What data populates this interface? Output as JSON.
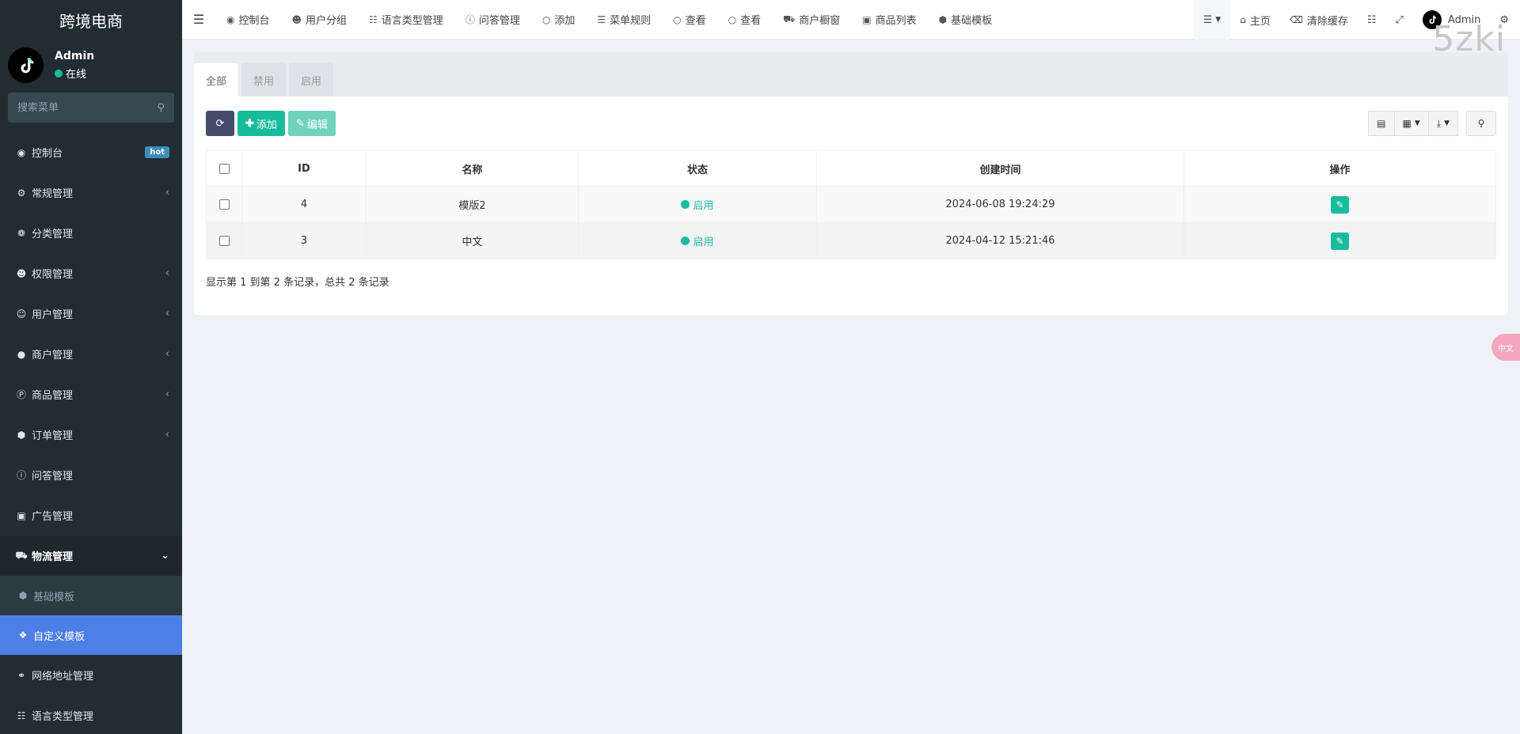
{
  "sidebar": {
    "logo": "跨境电商",
    "user": {
      "name": "Admin",
      "status": "在线"
    },
    "search_placeholder": "搜索菜单",
    "items": [
      {
        "label": "控制台",
        "icon": "dashboard-icon",
        "badge": "hot"
      },
      {
        "label": "常规管理",
        "icon": "cogs-icon"
      },
      {
        "label": "分类管理",
        "icon": "leaf-icon"
      },
      {
        "label": "权限管理",
        "icon": "group-icon"
      },
      {
        "label": "用户管理",
        "icon": "user-circle-icon"
      },
      {
        "label": "商户管理",
        "icon": "apple-icon"
      },
      {
        "label": "商品管理",
        "icon": "product-p-icon"
      },
      {
        "label": "订单管理",
        "icon": "cube-icon"
      },
      {
        "label": "问答管理",
        "icon": "question-circle-icon"
      },
      {
        "label": "广告管理",
        "icon": "ad-card-icon"
      },
      {
        "label": "物流管理",
        "icon": "truck-icon"
      },
      {
        "label": "基础模板",
        "icon": "cube-sub-icon"
      },
      {
        "label": "自定义模板",
        "icon": "cubes-icon"
      },
      {
        "label": "网络地址管理",
        "icon": "link-icon"
      },
      {
        "label": "语言类型管理",
        "icon": "translate-icon"
      }
    ]
  },
  "topbar": {
    "tabs": [
      {
        "label": "控制台",
        "icon": "dashboard-icon"
      },
      {
        "label": "用户分组",
        "icon": "group-icon"
      },
      {
        "label": "语言类型管理",
        "icon": "translate-icon"
      },
      {
        "label": "问答管理",
        "icon": "question-circle-icon"
      },
      {
        "label": "添加",
        "icon": "circle-icon"
      },
      {
        "label": "菜单规则",
        "icon": "bars-icon"
      },
      {
        "label": "查看",
        "icon": "circle-icon"
      },
      {
        "label": "查看",
        "icon": "circle-icon"
      },
      {
        "label": "商户橱窗",
        "icon": "cart-icon"
      },
      {
        "label": "商品列表",
        "icon": "bag-icon"
      },
      {
        "label": "基础模板",
        "icon": "cube-icon"
      }
    ],
    "right": {
      "home": "主页",
      "clear_cache": "清除缓存",
      "admin": "Admin"
    }
  },
  "content": {
    "filter_tabs": [
      "全部",
      "禁用",
      "启用"
    ],
    "toolbar": {
      "add": "添加",
      "edit": "编辑"
    },
    "table": {
      "headers": [
        "ID",
        "名称",
        "状态",
        "创建时间",
        "操作"
      ],
      "rows": [
        {
          "id": "4",
          "name": "模版2",
          "status": "启用",
          "created": "2024-06-08 19:24:29"
        },
        {
          "id": "3",
          "name": "中文",
          "status": "启用",
          "created": "2024-04-12 15:21:46"
        }
      ]
    },
    "summary": "显示第 1 到第 2 条记录，总共 2 条记录"
  },
  "corner_text": "5zki",
  "fab_label": "中文",
  "colors": {
    "sidebar": "#222d32",
    "accent": "#18bc9c",
    "active": "#4e7fe6",
    "refresh": "#444c69"
  }
}
